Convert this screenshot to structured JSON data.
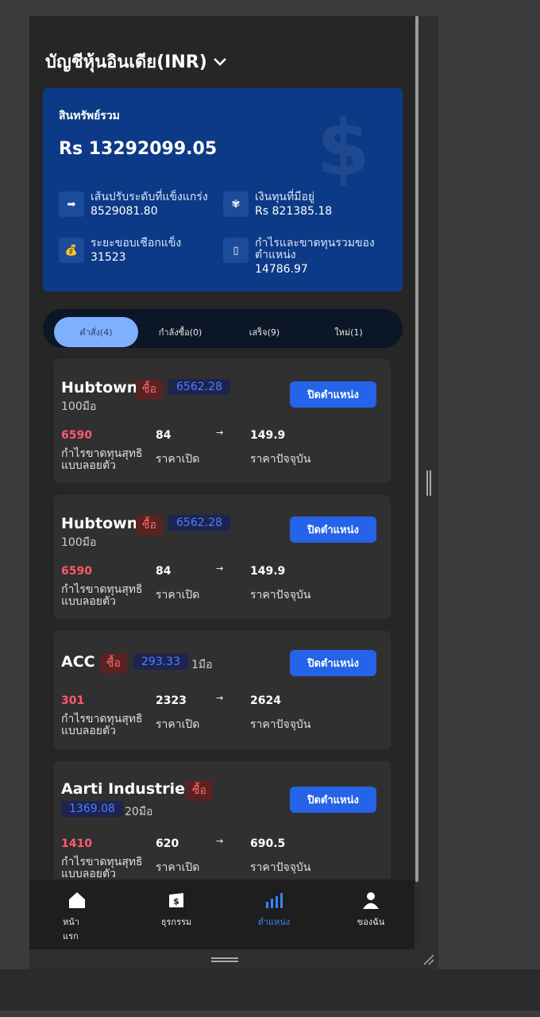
{
  "header": {
    "title": "บัญชีหุ้นอินเดีย(INR)"
  },
  "asset": {
    "label": "สินทรัพย์รวม",
    "value": "Rs 13292099.05",
    "metrics": [
      {
        "icon": "arrow-right-icon",
        "label": "เส้นปรับระดับที่แข็งแกร่ง",
        "value": "8529081.80"
      },
      {
        "icon": "money-bag-icon",
        "label": "เงินทุนที่มีอยู่",
        "value": "Rs 821385.18"
      },
      {
        "icon": "coin-bag-icon",
        "label": "ระยะขอบเชือกแข็ง",
        "value": "31523"
      },
      {
        "icon": "chart-icon",
        "label": "กำไรและขาดทุนรวมของตำแหน่ง",
        "value": "14786.97"
      }
    ]
  },
  "tabs": [
    {
      "label": "คำสั่ง(4)"
    },
    {
      "label": "กำลังซื้อ(0)"
    },
    {
      "label": "เสร็จ(9)"
    },
    {
      "label": "ใหม่(1)"
    }
  ],
  "positions": [
    {
      "name": "Hubtown",
      "side": "ซื้อ",
      "price": "6562.28",
      "qty": "100มือ",
      "button": "ปิดตำแหน่ง",
      "pnl": "6590",
      "open": "84",
      "arrow": "→",
      "current": "149.9",
      "pnl_label": "กำไรขาดทุนสุทธิแบบลอยตัว",
      "open_label": "ราคาเปิด",
      "current_label": "ราคาปัจจุบัน"
    },
    {
      "name": "Hubtown",
      "side": "ซื้อ",
      "price": "6562.28",
      "qty": "100มือ",
      "button": "ปิดตำแหน่ง",
      "pnl": "6590",
      "open": "84",
      "arrow": "→",
      "current": "149.9",
      "pnl_label": "กำไรขาดทุนสุทธิแบบลอยตัว",
      "open_label": "ราคาเปิด",
      "current_label": "ราคาปัจจุบัน"
    },
    {
      "name": "ACC",
      "side": "ซื้อ",
      "price": "293.33",
      "qty": "1มือ",
      "button": "ปิดตำแหน่ง",
      "pnl": "301",
      "open": "2323",
      "arrow": "→",
      "current": "2624",
      "pnl_label": "กำไรขาดทุนสุทธิแบบลอยตัว",
      "open_label": "ราคาเปิด",
      "current_label": "ราคาปัจจุบัน"
    },
    {
      "name": "Aarti Industries",
      "side": "ซื้อ",
      "price": "1369.08",
      "qty": "20มือ",
      "button": "ปิดตำแหน่ง",
      "pnl": "1410",
      "open": "620",
      "arrow": "→",
      "current": "690.5",
      "pnl_label": "กำไรขาดทุนสุทธิแบบลอยตัว",
      "open_label": "ราคาเปิด",
      "current_label": "ราคาปัจจุบัน"
    }
  ],
  "nav": [
    {
      "icon": "home-icon",
      "label": "หน้าแรก"
    },
    {
      "icon": "wallet-icon",
      "label": "ธุรกรรม"
    },
    {
      "icon": "bar-chart-icon",
      "label": "ตำแหน่ง"
    },
    {
      "icon": "person-icon",
      "label": "ของฉัน"
    }
  ],
  "colors": {
    "card_blue": "#0d3a86",
    "accent_blue": "#2563e8",
    "buy_red": "#ff6b6b",
    "pnl_red": "#ff5a6a",
    "nav_active": "#3b82f6"
  }
}
